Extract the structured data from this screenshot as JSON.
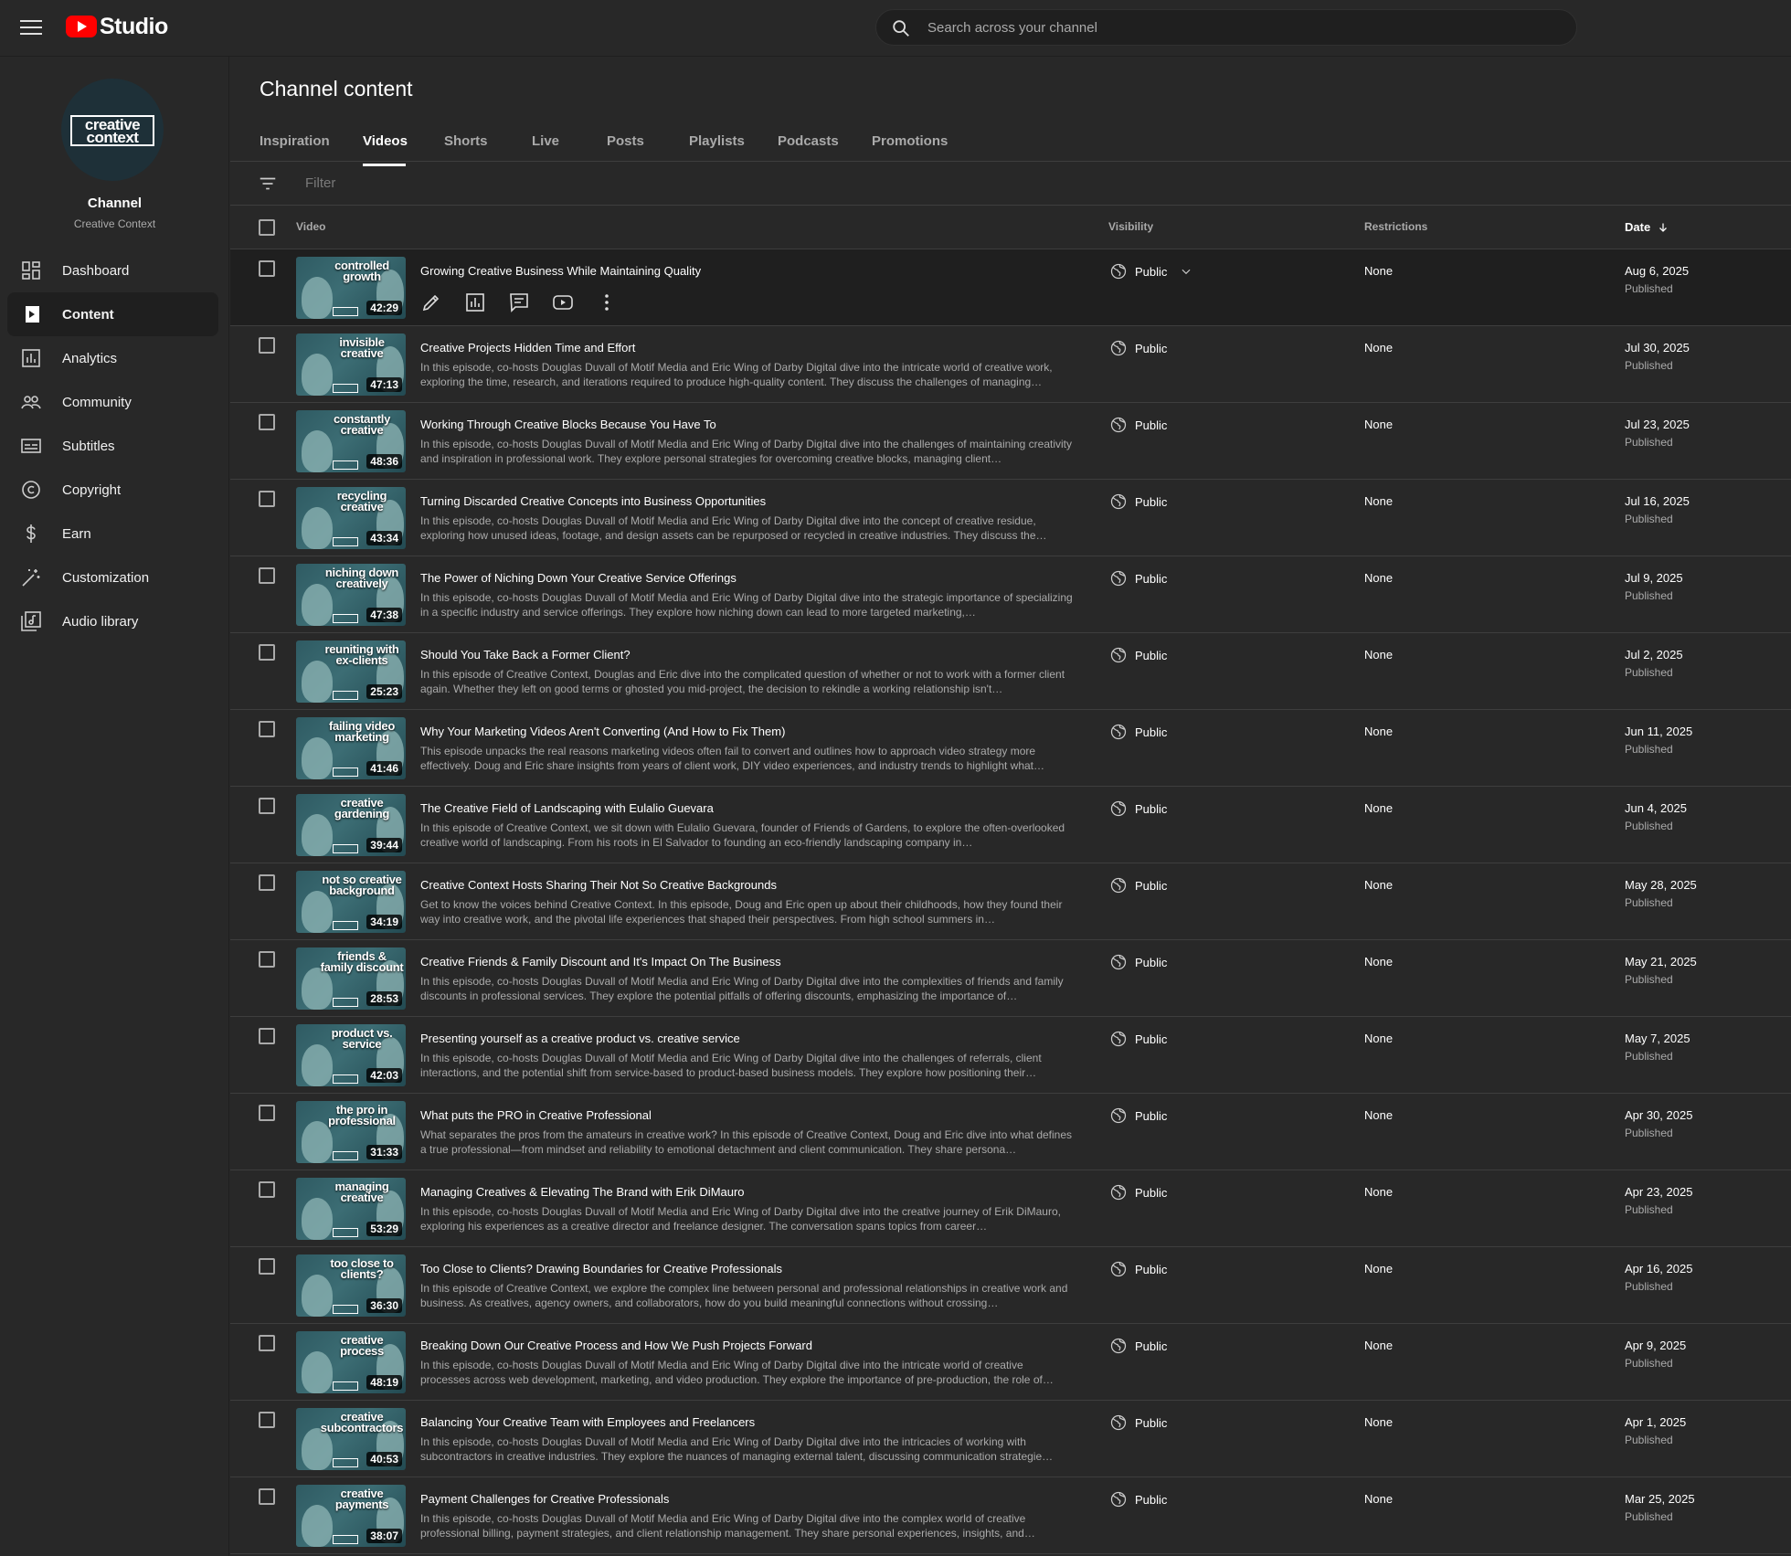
{
  "app": {
    "name": "Studio",
    "search_placeholder": "Search across your channel"
  },
  "colors": {
    "accent": "#ff0000",
    "bg": "#282828",
    "panel": "#1f1f1f",
    "muted": "#aaaaaa"
  },
  "sidebar": {
    "avatar_text": "creative context",
    "channel_title": "Channel",
    "channel_name": "Creative Context",
    "items": [
      {
        "label": "Dashboard",
        "icon": "dashboard-icon"
      },
      {
        "label": "Content",
        "icon": "content-icon",
        "active": true
      },
      {
        "label": "Analytics",
        "icon": "analytics-icon"
      },
      {
        "label": "Community",
        "icon": "community-icon"
      },
      {
        "label": "Subtitles",
        "icon": "subtitles-icon"
      },
      {
        "label": "Copyright",
        "icon": "copyright-icon"
      },
      {
        "label": "Earn",
        "icon": "dollar-icon"
      },
      {
        "label": "Customization",
        "icon": "magic-wand-icon"
      },
      {
        "label": "Audio library",
        "icon": "audio-library-icon"
      }
    ]
  },
  "main": {
    "title": "Channel content",
    "tabs": [
      "Inspiration",
      "Videos",
      "Shorts",
      "Live",
      "Posts",
      "Playlists",
      "Podcasts",
      "Promotions"
    ],
    "active_tab": "Videos",
    "filter_placeholder": "Filter",
    "columns": {
      "video": "Video",
      "visibility": "Visibility",
      "restrictions": "Restrictions",
      "date": "Date"
    }
  },
  "videos": [
    {
      "thumb_text": "controlled growth",
      "duration": "42:29",
      "title": "Growing Creative Business While Maintaining Quality",
      "description": "",
      "visibility": "Public",
      "restrictions": "None",
      "date": "Aug 6, 2025",
      "status": "Published"
    },
    {
      "thumb_text": "invisible creative",
      "duration": "47:13",
      "title": "Creative Projects Hidden Time and Effort",
      "description": "In this episode, co-hosts Douglas Duvall of Motif Media and Eric Wing of Darby Digital dive into the intricate world of creative work, exploring the time, research, and iterations required to produce high-quality content. They discuss the challenges of managing…",
      "visibility": "Public",
      "restrictions": "None",
      "date": "Jul 30, 2025",
      "status": "Published"
    },
    {
      "thumb_text": "constantly creative",
      "duration": "48:36",
      "title": "Working Through Creative Blocks Because You Have To",
      "description": "In this episode, co-hosts Douglas Duvall of Motif Media and Eric Wing of Darby Digital dive into the challenges of maintaining creativity and inspiration in professional work. They explore personal strategies for overcoming creative blocks, managing client…",
      "visibility": "Public",
      "restrictions": "None",
      "date": "Jul 23, 2025",
      "status": "Published"
    },
    {
      "thumb_text": "recycling creative",
      "duration": "43:34",
      "title": "Turning Discarded Creative Concepts into Business Opportunities",
      "description": "In this episode, co-hosts Douglas Duvall of Motif Media and Eric Wing of Darby Digital dive into the concept of creative residue, exploring how unused ideas, footage, and design assets can be repurposed or recycled in creative industries. They discuss the…",
      "visibility": "Public",
      "restrictions": "None",
      "date": "Jul 16, 2025",
      "status": "Published"
    },
    {
      "thumb_text": "niching down creatively",
      "duration": "47:38",
      "title": "The Power of Niching Down Your Creative Service Offerings",
      "description": "In this episode, co-hosts Douglas Duvall of Motif Media and Eric Wing of Darby Digital dive into the strategic importance of specializing in a specific industry and service offerings. They explore how niching down can lead to more targeted marketing,…",
      "visibility": "Public",
      "restrictions": "None",
      "date": "Jul 9, 2025",
      "status": "Published"
    },
    {
      "thumb_text": "reuniting with ex-clients",
      "duration": "25:23",
      "title": "Should You Take Back a Former Client?",
      "description": "In this episode of Creative Context, Douglas and Eric dive into the complicated question of whether or not to work with a former client again. Whether they left on good terms or ghosted you mid-project, the decision to rekindle a working relationship isn't…",
      "visibility": "Public",
      "restrictions": "None",
      "date": "Jul 2, 2025",
      "status": "Published"
    },
    {
      "thumb_text": "failing video marketing",
      "duration": "41:46",
      "title": "Why Your Marketing Videos Aren't Converting (And How to Fix Them)",
      "description": "This episode unpacks the real reasons marketing videos often fail to convert and outlines how to approach video strategy more effectively. Doug and Eric share insights from years of client work, DIY video experiences, and industry trends to highlight what…",
      "visibility": "Public",
      "restrictions": "None",
      "date": "Jun 11, 2025",
      "status": "Published"
    },
    {
      "thumb_text": "creative gardening",
      "duration": "39:44",
      "title": "The Creative Field of Landscaping with Eulalio Guevara",
      "description": "In this episode of Creative Context, we sit down with Eulalio Guevara, founder of Friends of Gardens, to explore the often-overlooked creative world of landscaping. From his roots in El Salvador to founding an eco-friendly landscaping company in…",
      "visibility": "Public",
      "restrictions": "None",
      "date": "Jun 4, 2025",
      "status": "Published"
    },
    {
      "thumb_text": "not so creative background",
      "duration": "34:19",
      "title": "Creative Context Hosts Sharing Their Not So Creative Backgrounds",
      "description": "Get to know the voices behind Creative Context. In this episode, Doug and Eric open up about their childhoods, how they found their way into creative work, and the pivotal life experiences that shaped their perspectives. From high school summers in…",
      "visibility": "Public",
      "restrictions": "None",
      "date": "May 28, 2025",
      "status": "Published"
    },
    {
      "thumb_text": "friends & family discount",
      "duration": "28:53",
      "title": "Creative Friends & Family Discount and It's Impact On The Business",
      "description": "In this episode, co-hosts Douglas Duvall of Motif Media and Eric Wing of Darby Digital dive into the complexities of friends and family discounts in professional services. They explore the potential pitfalls of offering discounts, emphasizing the importance of…",
      "visibility": "Public",
      "restrictions": "None",
      "date": "May 21, 2025",
      "status": "Published"
    },
    {
      "thumb_text": "product vs. service",
      "duration": "42:03",
      "title": "Presenting yourself as a creative product vs. creative service",
      "description": "In this episode, co-hosts Douglas Duvall of Motif Media and Eric Wing of Darby Digital dive into the challenges of referrals, client interactions, and the potential shift from service-based to product-based business models. They explore how positioning their…",
      "visibility": "Public",
      "restrictions": "None",
      "date": "May 7, 2025",
      "status": "Published"
    },
    {
      "thumb_text": "the pro in professional",
      "duration": "31:33",
      "title": "What puts the PRO in Creative Professional",
      "description": "What separates the pros from the amateurs in creative work? In this episode of Creative Context, Doug and Eric dive into what defines a true professional—from mindset and reliability to emotional detachment and client communication. They share persona…",
      "visibility": "Public",
      "restrictions": "None",
      "date": "Apr 30, 2025",
      "status": "Published"
    },
    {
      "thumb_text": "managing creative",
      "duration": "53:29",
      "title": "Managing Creatives & Elevating The Brand with Erik DiMauro",
      "description": "In this episode, co-hosts Douglas Duvall of Motif Media and Eric Wing of Darby Digital dive into the creative journey of Erik DiMauro, exploring his experiences as a creative director and freelance designer. The conversation spans topics from career…",
      "visibility": "Public",
      "restrictions": "None",
      "date": "Apr 23, 2025",
      "status": "Published"
    },
    {
      "thumb_text": "too close to clients?",
      "duration": "36:30",
      "title": "Too Close to Clients? Drawing Boundaries for Creative Professionals",
      "description": "In this episode of Creative Context, we explore the complex line between personal and professional relationships in creative work and business. As creatives, agency owners, and collaborators, how do you build meaningful connections without crossing…",
      "visibility": "Public",
      "restrictions": "None",
      "date": "Apr 16, 2025",
      "status": "Published"
    },
    {
      "thumb_text": "creative process",
      "duration": "48:19",
      "title": "Breaking Down Our Creative Process and How We Push Projects Forward",
      "description": "In this episode, co-hosts Douglas Duvall of Motif Media and Eric Wing of Darby Digital dive into the intricate world of creative processes across web development, marketing, and video production. They explore the importance of pre-production, the role of…",
      "visibility": "Public",
      "restrictions": "None",
      "date": "Apr 9, 2025",
      "status": "Published"
    },
    {
      "thumb_text": "creative subcontractors",
      "duration": "40:53",
      "title": "Balancing Your Creative Team with Employees and Freelancers",
      "description": "In this episode, co-hosts Douglas Duvall of Motif Media and Eric Wing of Darby Digital dive into the intricacies of working with subcontractors in creative industries. They explore the nuances of managing external talent, discussing communication strategie…",
      "visibility": "Public",
      "restrictions": "None",
      "date": "Apr 1, 2025",
      "status": "Published"
    },
    {
      "thumb_text": "creative payments",
      "duration": "38:07",
      "title": "Payment Challenges for Creative Professionals",
      "description": "In this episode, co-hosts Douglas Duvall of Motif Media and Eric Wing of Darby Digital dive into the complex world of creative professional billing, payment strategies, and client relationship management. They share personal experiences, insights, and…",
      "visibility": "Public",
      "restrictions": "None",
      "date": "Mar 25, 2025",
      "status": "Published"
    }
  ],
  "row_actions": [
    "pencil-icon",
    "analytics-icon",
    "comments-icon",
    "youtube-icon",
    "more-vert-icon"
  ]
}
